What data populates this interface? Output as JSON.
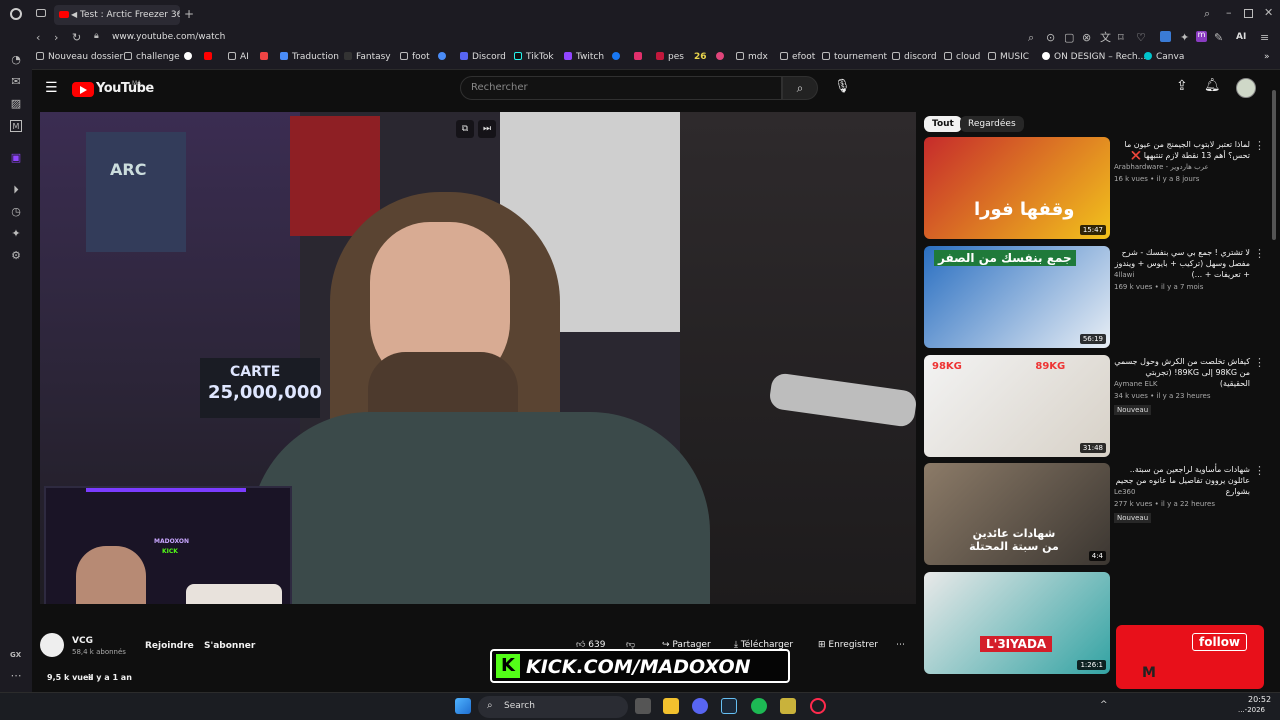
{
  "browser": {
    "tab_title": "Test : Arctic Freezer 36",
    "url": "www.youtube.com/watch",
    "ai_label": "AI",
    "bookmarks": [
      "Nouveau dossier",
      "challenge",
      "AI",
      "Traduction",
      "Fantasy",
      "foot",
      "Discord",
      "TikTok",
      "Twitch",
      "pes",
      "26",
      "mdx",
      "efoot",
      "tournement",
      "discord",
      "cloud",
      "MUSIC",
      "ON DESIGN – Rech...",
      "Canva"
    ],
    "gx_label": "GX"
  },
  "youtube": {
    "logo_text": "YouTube",
    "region": "MA",
    "search_placeholder": "Rechercher",
    "chips": [
      "Tout",
      "Regardées"
    ]
  },
  "video": {
    "overlay_text_line1": "CARTE",
    "overlay_text_line2": "25,000,000",
    "arc_label": "ARC",
    "stream_logo": "MADOXON",
    "stream_kick": "KICK",
    "kick_banner": "KICK.COM/MADOXON",
    "progress_number": "1"
  },
  "channel": {
    "name": "VCG",
    "subscribers": "58,4 k abonnés",
    "join_label": "Rejoindre",
    "subscribe_label": "S'abonner",
    "views": "9,5 k vues",
    "age": "il y a 1 an"
  },
  "actions": {
    "likes": "639",
    "share": "Partager",
    "download": "Télécharger",
    "save": "Enregistrer"
  },
  "recommendations": [
    {
      "title": "لماذا تعتبر لابتوب الجيمنج من عيون ما تحس؟ أهم 13 نقطة لازم تنتبهها ❌",
      "channel": "Arabhardware - عرب هاردوير",
      "meta": "16 k vues • il y a 8 jours",
      "duration": "15:47",
      "thumb_text": "وقفها فورا",
      "badge": ""
    },
    {
      "title": "لا تشتري ! جمع بي سي بنفسك - شرح مفصل وسهل (تركيب + بايوس + ويندوز + تعريفات + ...)",
      "channel": "4llawi",
      "meta": "169 k vues • il y a 7 mois",
      "duration": "56:19",
      "thumb_text": "جمع بنفسك من الصفر",
      "badge": ""
    },
    {
      "title": "كيفاش تخلصت من الكرش وحول جسمي من 98KG إلى 89KG! (تجربتي الحقيقية)",
      "channel": "Aymane ELK",
      "meta": "34 k vues • il y a 23 heures",
      "duration": "31:48",
      "thumb_text": "98KG 89KG",
      "badge": "Nouveau"
    },
    {
      "title": "شهادات مأساوية لراجعين من سبتة.. عائلون يروون تفاصيل ما عانوه من جحيم بشوارع",
      "channel": "Le360",
      "meta": "277 k vues • il y a 22 heures",
      "duration": "4:4",
      "thumb_text": "شهادات عائدين من سبتة المحتلة",
      "badge": "Nouveau"
    },
    {
      "title": "",
      "channel": "",
      "meta": "",
      "duration": "1:26:1",
      "thumb_text": "L'3IYADA",
      "badge": ""
    }
  ],
  "follow_overlay": {
    "label": "follow",
    "letter": "M"
  },
  "taskbar": {
    "search": "Search",
    "time": "20:52",
    "date": "...-2026"
  }
}
